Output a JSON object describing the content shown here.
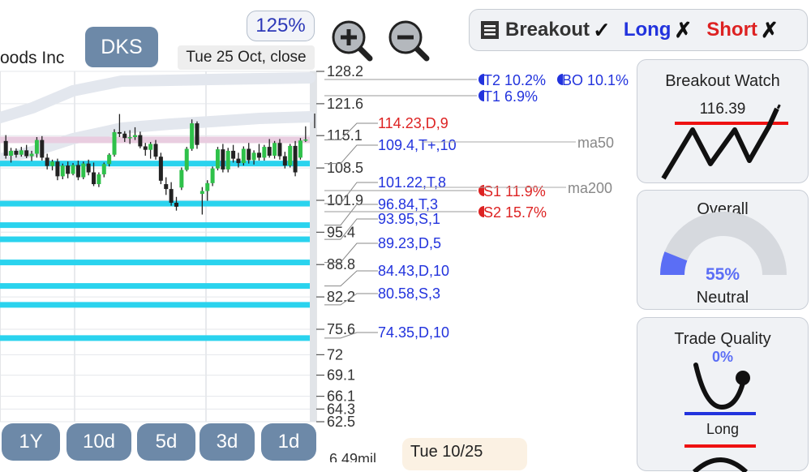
{
  "company_name": "oods Inc",
  "ticker": "DKS",
  "zoom_level": "125%",
  "chart_date": "Tue 25 Oct, close",
  "toolbar": {
    "breakout": "Breakout",
    "long": "Long",
    "short": "Short",
    "check": "✓",
    "cross": "✗"
  },
  "panels": {
    "breakout_watch": {
      "title": "Breakout Watch",
      "value": "116.39"
    },
    "overall": {
      "title": "Overall",
      "percent": "55%",
      "level": 0.55,
      "label": "Neutral"
    },
    "trade_quality": {
      "title": "Trade Quality",
      "percent": "0%",
      "label": "Long"
    }
  },
  "range_buttons": [
    "1Y",
    "10d",
    "5d",
    "3d",
    "1d"
  ],
  "footer_date": "Tue 10/25",
  "volume_label": "6.49mil",
  "colors": {
    "support": "#2ad3ee",
    "resistance_band": "#e9cde0",
    "blue_text": "#2233dd",
    "red_text": "#dd2222",
    "ma_band": "#e3e7ee"
  },
  "chart_data": {
    "type": "candlestick",
    "y_ticks": [
      "128.2",
      "121.6",
      "115.1",
      "108.5",
      "101.9",
      "95.4",
      "88.8",
      "82.2",
      "75.6",
      "72",
      "69.1",
      "66.1",
      "64.3",
      "62.5"
    ],
    "y_tick_values": [
      128.2,
      121.6,
      115.1,
      108.5,
      101.9,
      95.4,
      88.8,
      82.2,
      75.6,
      72,
      69.1,
      66.1,
      64.3,
      62.5
    ],
    "support_lines": [
      {
        "label": "114.23,D,9",
        "value": 114.23,
        "color": "red"
      },
      {
        "label": "109.4,T+,10",
        "value": 109.4,
        "color": "blue"
      },
      {
        "label": "101.22,T,8",
        "value": 101.22,
        "color": "blue"
      },
      {
        "label": "96.84,T,3",
        "value": 96.84,
        "color": "blue"
      },
      {
        "label": "93.95,S,1",
        "value": 93.95,
        "color": "blue"
      },
      {
        "label": "89.23,D,5",
        "value": 89.23,
        "color": "blue"
      },
      {
        "label": "84.43,D,10",
        "value": 84.43,
        "color": "blue"
      },
      {
        "label": "80.58,S,3",
        "value": 80.58,
        "color": "blue"
      },
      {
        "label": "74.35,D,10",
        "value": 74.35,
        "color": "blue"
      }
    ],
    "targets": [
      {
        "label": "T2 10.2%",
        "value": 128.2,
        "color": "blue"
      },
      {
        "label": "BO 10.1%",
        "value": 128.2,
        "color": "blue"
      },
      {
        "label": "T1 6.9%",
        "value": 124.2,
        "color": "blue"
      },
      {
        "label": "S1 11.9%",
        "value": 102.4,
        "color": "red"
      },
      {
        "label": "S2 15.7%",
        "value": 98.1,
        "color": "red"
      }
    ],
    "ma_labels": [
      {
        "label": "ma50",
        "value": 109.6
      },
      {
        "label": "ma200",
        "value": 102.9
      }
    ],
    "candles": [
      [
        114.0,
        115.2,
        110.4,
        111.0
      ],
      [
        111.0,
        112.6,
        109.6,
        112.0
      ],
      [
        112.0,
        112.5,
        110.6,
        111.2
      ],
      [
        111.2,
        112.8,
        110.8,
        112.1
      ],
      [
        112.1,
        113.2,
        110.5,
        110.9
      ],
      [
        110.9,
        112.0,
        109.9,
        111.4
      ],
      [
        111.4,
        114.8,
        110.6,
        114.2
      ],
      [
        114.2,
        115.0,
        110.0,
        110.6
      ],
      [
        110.6,
        111.4,
        108.2,
        108.9
      ],
      [
        108.9,
        110.2,
        108.0,
        109.8
      ],
      [
        109.8,
        110.4,
        106.0,
        106.8
      ],
      [
        106.8,
        109.4,
        106.2,
        109.0
      ],
      [
        109.0,
        109.8,
        106.4,
        107.3
      ],
      [
        107.3,
        109.5,
        107.0,
        109.1
      ],
      [
        109.1,
        110.0,
        106.0,
        106.6
      ],
      [
        106.6,
        109.8,
        106.2,
        109.4
      ],
      [
        109.4,
        110.2,
        107.0,
        107.6
      ],
      [
        107.6,
        109.6,
        104.8,
        105.2
      ],
      [
        105.2,
        107.6,
        104.6,
        107.2
      ],
      [
        107.2,
        109.6,
        106.6,
        109.3
      ],
      [
        109.3,
        111.5,
        108.8,
        111.2
      ],
      [
        111.2,
        116.4,
        110.8,
        115.8
      ],
      [
        115.8,
        119.5,
        114.8,
        115.5
      ],
      [
        115.5,
        116.0,
        113.8,
        114.6
      ],
      [
        114.6,
        116.2,
        113.4,
        114.8
      ],
      [
        114.8,
        116.8,
        114.2,
        115.2
      ],
      [
        115.2,
        115.9,
        112.5,
        112.9
      ],
      [
        112.9,
        113.6,
        111.0,
        112.2
      ],
      [
        112.2,
        113.8,
        110.4,
        113.4
      ],
      [
        113.4,
        114.2,
        110.2,
        110.8
      ],
      [
        110.8,
        111.6,
        105.2,
        105.9
      ],
      [
        105.2,
        106.6,
        103.0,
        104.2
      ],
      [
        104.2,
        105.6,
        100.8,
        101.4
      ],
      [
        101.4,
        102.6,
        99.8,
        100.6
      ],
      [
        104.5,
        108.6,
        104.0,
        108.1
      ],
      [
        108.1,
        112.8,
        107.8,
        112.4
      ],
      [
        112.4,
        118.4,
        112.0,
        117.6
      ],
      [
        117.6,
        118.0,
        112.4,
        113.2
      ],
      [
        103.2,
        104.6,
        99.0,
        103.8
      ],
      [
        103.8,
        106.0,
        101.8,
        105.4
      ],
      [
        105.4,
        108.8,
        104.8,
        108.4
      ],
      [
        108.4,
        112.8,
        108.0,
        112.3
      ],
      [
        112.3,
        113.4,
        107.6,
        108.2
      ],
      [
        108.2,
        112.6,
        107.6,
        112.0
      ],
      [
        112.0,
        113.2,
        109.6,
        110.4
      ],
      [
        110.4,
        111.6,
        108.6,
        109.5
      ],
      [
        109.5,
        112.9,
        109.0,
        112.4
      ],
      [
        112.4,
        113.6,
        109.4,
        110.1
      ],
      [
        110.1,
        112.1,
        109.2,
        111.6
      ],
      [
        111.6,
        113.4,
        110.0,
        110.6
      ],
      [
        110.6,
        113.2,
        110.0,
        112.8
      ],
      [
        112.8,
        114.4,
        110.6,
        111.0
      ],
      [
        111.0,
        114.0,
        110.4,
        113.6
      ],
      [
        113.6,
        114.4,
        110.2,
        110.9
      ],
      [
        110.9,
        111.8,
        108.4,
        109.0
      ],
      [
        109.0,
        113.4,
        108.6,
        113.0
      ],
      [
        113.0,
        114.0,
        106.8,
        107.6
      ],
      [
        110.6,
        114.6,
        110.2,
        114.1
      ],
      [
        114.1,
        117.0,
        113.8,
        114.3
      ]
    ]
  }
}
